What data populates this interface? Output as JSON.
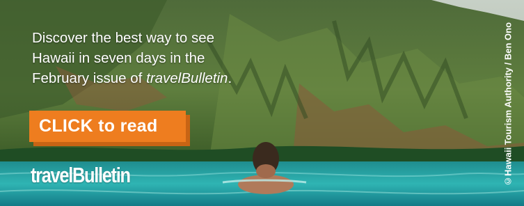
{
  "ad": {
    "headline_line1": "Discover the best way to see",
    "headline_line2": "Hawaii in seven days in the",
    "headline_line3_prefix": "February issue of ",
    "headline_line3_italic": "travelBulletin",
    "headline_line3_suffix": ".",
    "cta_label": "CLICK to read",
    "logo_text": "travelBulletin",
    "photo_credit": "©Hawaii Tourism Authority / Ben Ono"
  },
  "colors": {
    "accent": "#ee7d1f",
    "accent_shadow": "#c86414",
    "text": "#ffffff",
    "credit_bar": "#1e2a1c"
  },
  "image": {
    "subject": "photo of a swimmer in turquoise water below green Hawaiian cliffs"
  }
}
